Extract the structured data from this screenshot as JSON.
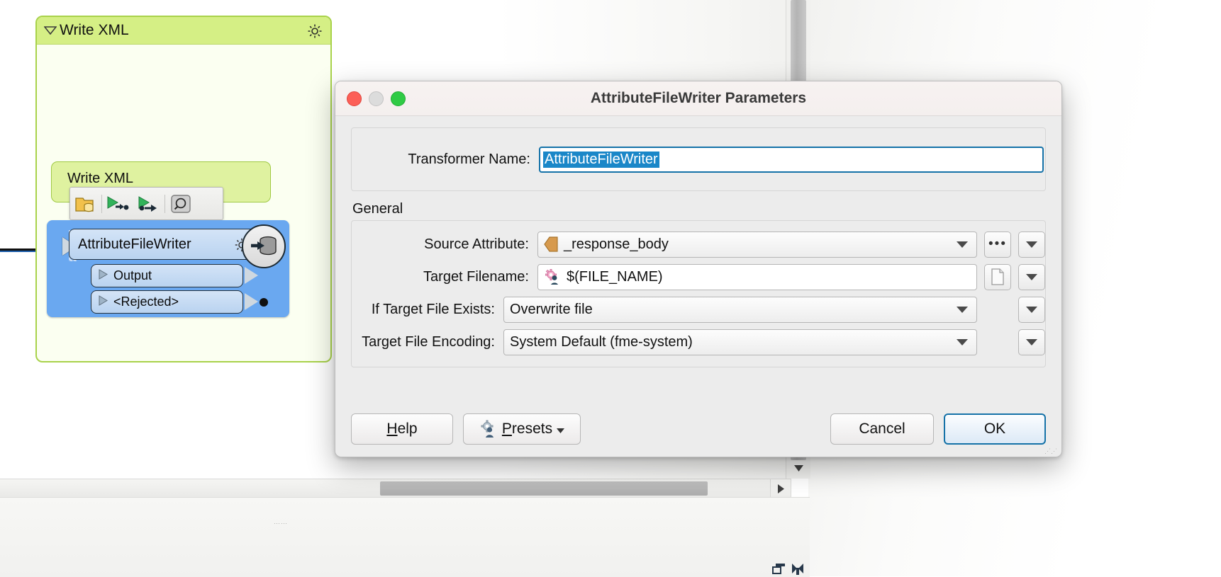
{
  "workspace": {
    "bookmark": {
      "title": "Write XML",
      "collapse_icon": "triangle-down-icon",
      "gear_icon": "gear-icon"
    },
    "inner_bookmark": {
      "title": "Write XML"
    },
    "node_toolbar": {
      "items": [
        {
          "name": "folder-database-icon",
          "tooltip": "Open Containing Folder"
        },
        {
          "name": "run-to-this-icon",
          "tooltip": "Run To This"
        },
        {
          "name": "run-from-this-icon",
          "tooltip": "Run From This"
        },
        {
          "name": "inspect-magnifier-icon",
          "tooltip": "Inspect"
        }
      ]
    },
    "node": {
      "name": "AttributeFileWriter",
      "gear_icon": "gear-icon",
      "badge_icon": "writer-database-icon",
      "ports": [
        {
          "label": "Output",
          "icon": "triangle-right-icon"
        },
        {
          "label": "<Rejected>",
          "icon": "triangle-right-icon"
        }
      ],
      "selected_color": "#6aa8f0"
    }
  },
  "dialog": {
    "title": "AttributeFileWriter Parameters",
    "window_controls": [
      {
        "name": "close-button",
        "color": "#fc5f57"
      },
      {
        "name": "minimize-button",
        "color": "#dcdcdc"
      },
      {
        "name": "maximize-button",
        "color": "#2fcb45"
      }
    ],
    "transformer_name": {
      "label": "Transformer Name:",
      "value": "AttributeFileWriter",
      "selected": true
    },
    "general": {
      "section_label": "General",
      "fields": [
        {
          "label": "Source Attribute:",
          "value": "_response_body",
          "icon": "attribute-tag-icon",
          "control": "combo",
          "side_buttons": [
            "ellipsis-button",
            "dropdown-button"
          ]
        },
        {
          "label": "Target Filename:",
          "value": "$(FILE_NAME)",
          "icon": "user-parameter-icon",
          "control": "text",
          "side_buttons": [
            "file-browse-button",
            "dropdown-button"
          ]
        },
        {
          "label": "If Target File Exists:",
          "value": "Overwrite file",
          "control": "combo",
          "side_buttons": [
            "dropdown-button"
          ]
        },
        {
          "label": "Target File Encoding:",
          "value": "System Default (fme-system)",
          "control": "combo",
          "side_buttons": [
            "dropdown-button"
          ]
        }
      ]
    },
    "footer": {
      "help": "Help",
      "presets": "Presets",
      "presets_icon": "presets-gear-person-icon",
      "cancel": "Cancel",
      "ok": "OK"
    }
  },
  "chrome": {
    "scrollbar_down_icon": "triangle-down-icon",
    "scrollbar_right_icon": "triangle-right-icon",
    "status_icons": [
      "window-layout-icon",
      "collapse-icon"
    ]
  }
}
